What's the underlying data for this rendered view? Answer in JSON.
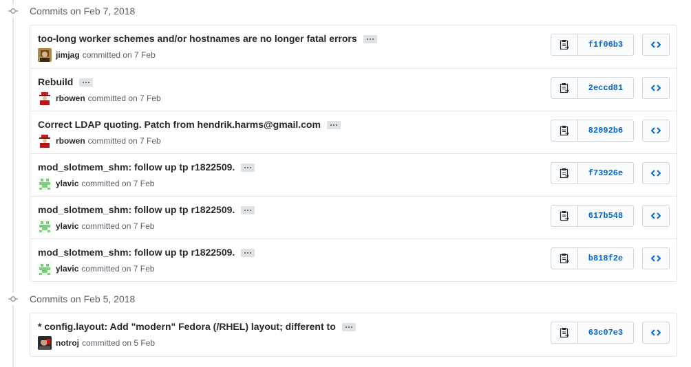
{
  "groups": [
    {
      "title": "Commits on Feb 7, 2018",
      "commits": [
        {
          "message": "too-long worker schemes and/or hostnames are no longer fatal errors",
          "author": "jimjag",
          "committed": "committed on 7 Feb",
          "sha": "f1f06b3",
          "avatar": "jimjag"
        },
        {
          "message": "Rebuild",
          "author": "rbowen",
          "committed": "committed on 7 Feb",
          "sha": "2eccd81",
          "avatar": "rbowen"
        },
        {
          "message": "Correct LDAP quoting. Patch from hendrik.harms@gmail.com",
          "author": "rbowen",
          "committed": "committed on 7 Feb",
          "sha": "82092b6",
          "avatar": "rbowen"
        },
        {
          "message": "mod_slotmem_shm: follow up tp r1822509.",
          "author": "ylavic",
          "committed": "committed on 7 Feb",
          "sha": "f73926e",
          "avatar": "ylavic"
        },
        {
          "message": "mod_slotmem_shm: follow up tp r1822509.",
          "author": "ylavic",
          "committed": "committed on 7 Feb",
          "sha": "617b548",
          "avatar": "ylavic"
        },
        {
          "message": "mod_slotmem_shm: follow up tp r1822509.",
          "author": "ylavic",
          "committed": "committed on 7 Feb",
          "sha": "b818f2e",
          "avatar": "ylavic"
        }
      ]
    },
    {
      "title": "Commits on Feb 5, 2018",
      "commits": [
        {
          "message": "* config.layout: Add \"modern\" Fedora (/RHEL) layout; different to",
          "author": "notroj",
          "committed": "committed on 5 Feb",
          "sha": "63c07e3",
          "avatar": "notroj"
        }
      ]
    }
  ],
  "colors": {
    "link": "#0366d6",
    "border": "#e1e4e8",
    "muted": "#586069"
  },
  "icons": {
    "timeline": "git-commit-icon",
    "copy": "clippy-icon",
    "browse": "code-icon",
    "more": "ellipsis-icon"
  }
}
